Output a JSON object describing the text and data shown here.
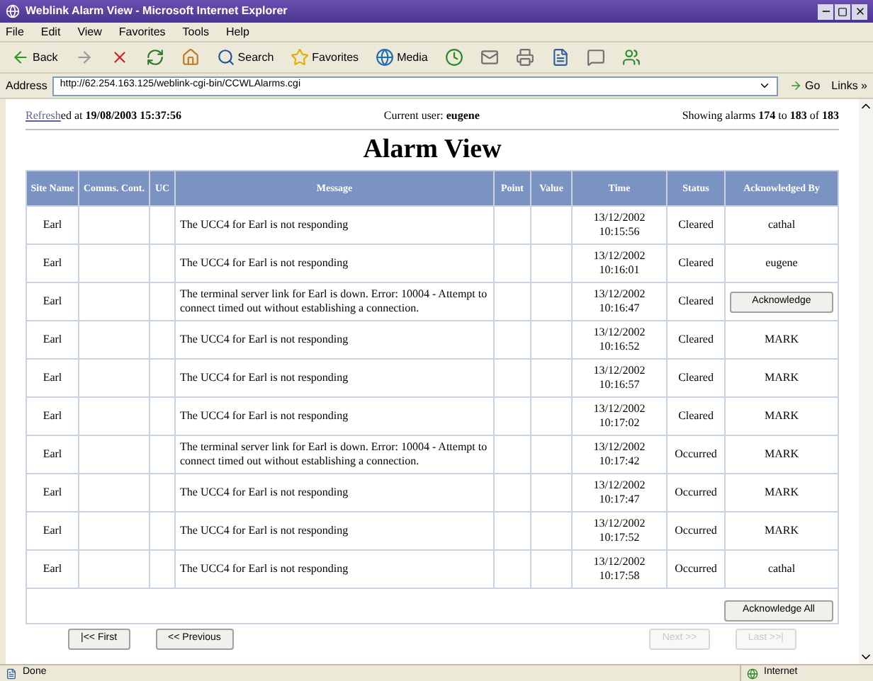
{
  "window": {
    "title": "Weblink Alarm View - Microsoft Internet Explorer"
  },
  "menu": [
    "File",
    "Edit",
    "View",
    "Favorites",
    "Tools",
    "Help"
  ],
  "toolbar": {
    "back": "Back",
    "search": "Search",
    "favorites": "Favorites",
    "media": "Media"
  },
  "address": {
    "label": "Address",
    "url": "http://62.254.163.125/weblink-cgi-bin/CCWLAlarms.cgi",
    "go": "Go",
    "links": "Links »"
  },
  "info": {
    "refresh_link": "Refresh",
    "refreshed": "ed at **19/08/2003 15:37:56**",
    "current_user": "Current user: **eugene**",
    "showing": "Showing alarms **174** to **183** of **183**"
  },
  "page_title": "Alarm View",
  "table": {
    "columns": [
      "Site Name",
      "Comms. Cont.",
      "UC",
      "Message",
      "Point",
      "Value",
      "Time",
      "Status",
      "Acknowledged By"
    ],
    "rows": [
      {
        "site": "Earl",
        "message": "The UCC4 for Earl is not responding",
        "date": "13/12/2002",
        "time": "10:15:56",
        "status": "Cleared",
        "ack": {
          "kind": "text",
          "label": "cathal"
        }
      },
      {
        "site": "Earl",
        "message": "The UCC4 for Earl is not responding",
        "date": "13/12/2002",
        "time": "10:16:01",
        "status": "Cleared",
        "ack": {
          "kind": "text",
          "label": "eugene"
        }
      },
      {
        "site": "Earl",
        "message": "The terminal server link for Earl is down. Error: 10004 - Attempt to connect timed out without establishing a connection.",
        "date": "13/12/2002",
        "time": "10:16:47",
        "status": "Cleared",
        "ack": {
          "kind": "button",
          "label": "Acknowledge"
        }
      },
      {
        "site": "Earl",
        "message": "The UCC4 for Earl is not responding",
        "date": "13/12/2002",
        "time": "10:16:52",
        "status": "Cleared",
        "ack": {
          "kind": "text",
          "label": "MARK"
        }
      },
      {
        "site": "Earl",
        "message": "The UCC4 for Earl is not responding",
        "date": "13/12/2002",
        "time": "10:16:57",
        "status": "Cleared",
        "ack": {
          "kind": "text",
          "label": "MARK"
        }
      },
      {
        "site": "Earl",
        "message": "The UCC4 for Earl is not responding",
        "date": "13/12/2002",
        "time": "10:17:02",
        "status": "Cleared",
        "ack": {
          "kind": "text",
          "label": "MARK"
        }
      },
      {
        "site": "Earl",
        "message": "The terminal server link for Earl is down. Error: 10004 - Attempt to connect timed out without establishing a connection.",
        "date": "13/12/2002",
        "time": "10:17:42",
        "status": "Occurred",
        "ack": {
          "kind": "text",
          "label": "MARK"
        }
      },
      {
        "site": "Earl",
        "message": "The UCC4 for Earl is not responding",
        "date": "13/12/2002",
        "time": "10:17:47",
        "status": "Occurred",
        "ack": {
          "kind": "text",
          "label": "MARK"
        }
      },
      {
        "site": "Earl",
        "message": "The UCC4 for Earl is not responding",
        "date": "13/12/2002",
        "time": "10:17:52",
        "status": "Occurred",
        "ack": {
          "kind": "text",
          "label": "MARK"
        }
      },
      {
        "site": "Earl",
        "message": "The UCC4 for Earl is not responding",
        "date": "13/12/2002",
        "time": "10:17:58",
        "status": "Occurred",
        "ack": {
          "kind": "text",
          "label": "cathal"
        }
      }
    ]
  },
  "acknowledge_all": "Acknowledge All",
  "nav": [
    {
      "label": "|<< First",
      "disabled": false
    },
    {
      "label": "<< Previous",
      "disabled": false
    },
    {
      "label": "Next >>",
      "disabled": true
    },
    {
      "label": "Last >>|",
      "disabled": true
    }
  ],
  "status_bar": {
    "text": "Done",
    "zone": "Internet"
  }
}
